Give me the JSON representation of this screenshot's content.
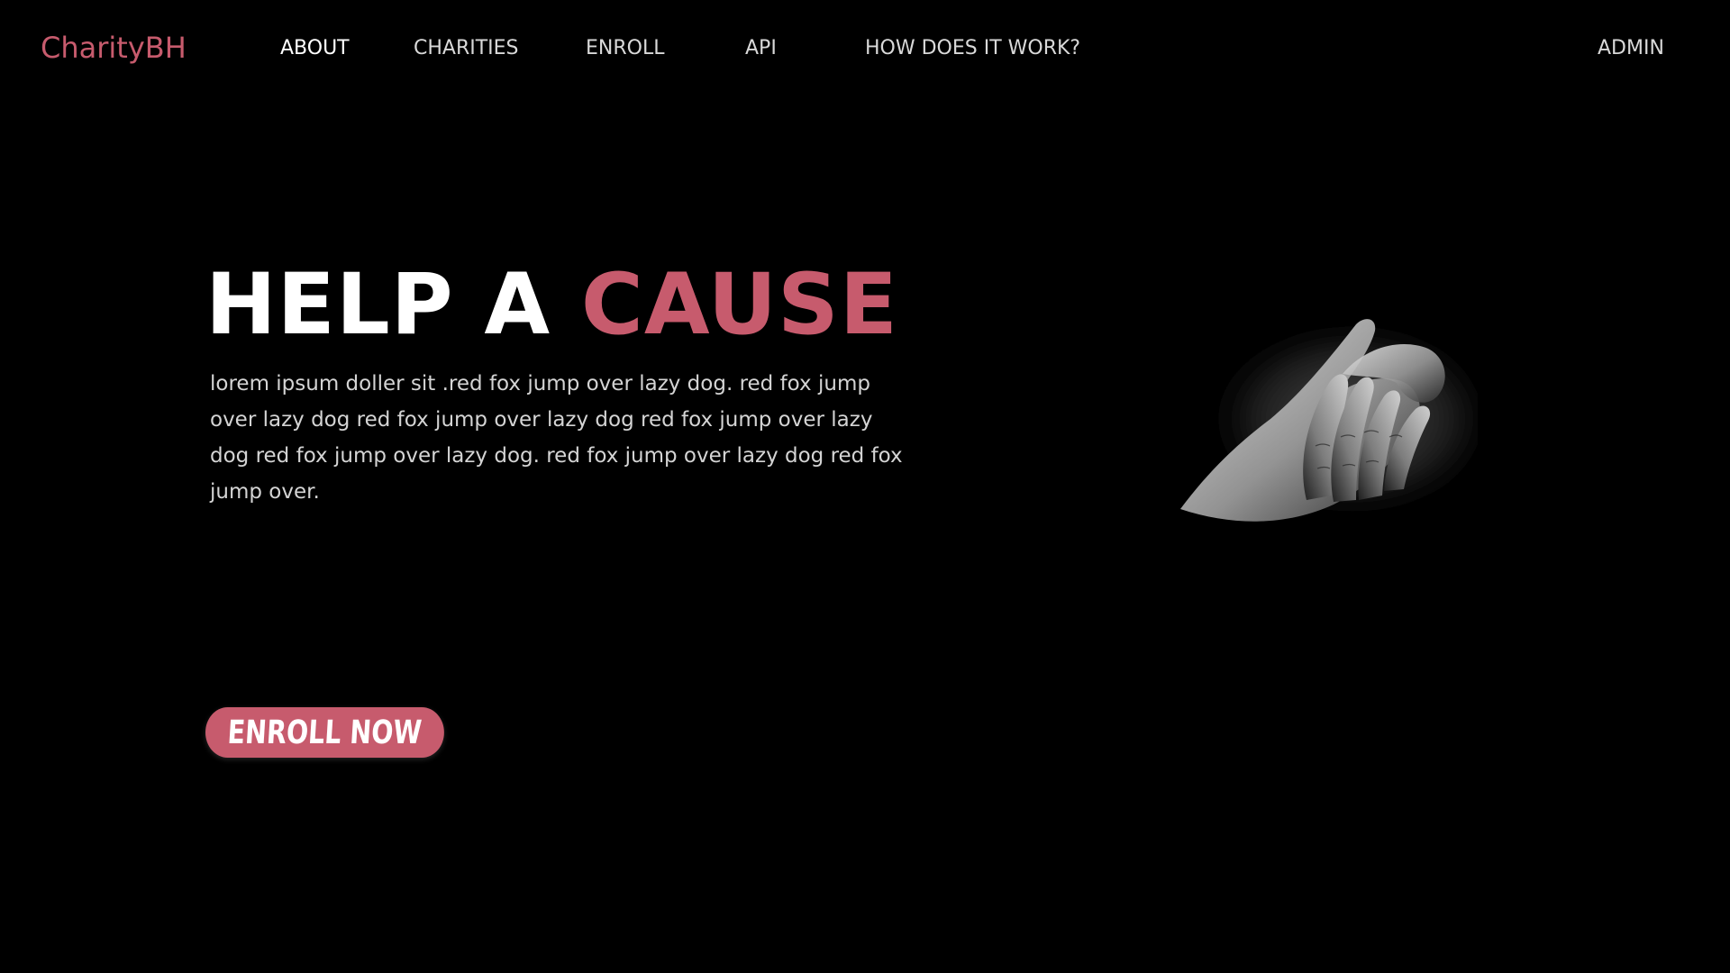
{
  "brand": {
    "name": "CharityBH",
    "color": "#c75b6d"
  },
  "nav": {
    "about": "ABOUT",
    "charities": "CHARITIES",
    "enroll": "ENROLL",
    "api": "API",
    "how": "HOW DOES IT WORK?",
    "admin": "ADMIN"
  },
  "hero": {
    "title_white": "HELP A ",
    "title_accent": "CAUSE",
    "body": "lorem ipsum doller sit .red fox jump over lazy dog. red fox jump over lazy dog red fox jump over lazy dog red fox jump over lazy dog red fox jump over lazy dog. red fox jump over lazy dog red fox jump over.",
    "cta": "ENROLL NOW"
  },
  "image": {
    "icon": "holding-hands-photo"
  }
}
